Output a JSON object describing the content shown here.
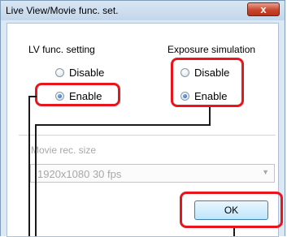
{
  "window": {
    "title": "Live View/Movie func. set.",
    "close_glyph": "x"
  },
  "lv_func": {
    "title": "LV func. setting",
    "options": [
      {
        "label": "Disable",
        "selected": false
      },
      {
        "label": "Enable",
        "selected": true
      }
    ]
  },
  "exposure_sim": {
    "title": "Exposure simulation",
    "options": [
      {
        "label": "Disable",
        "selected": false
      },
      {
        "label": "Enable",
        "selected": true
      }
    ]
  },
  "movie": {
    "label": "Movie rec. size",
    "value": "1920x1080  30 fps",
    "enabled": false
  },
  "ok_button": {
    "label": "OK"
  },
  "colors": {
    "highlight": "#e8161c",
    "title_bar": "#c3d6ea",
    "disabled_text": "#a8a8a8"
  }
}
